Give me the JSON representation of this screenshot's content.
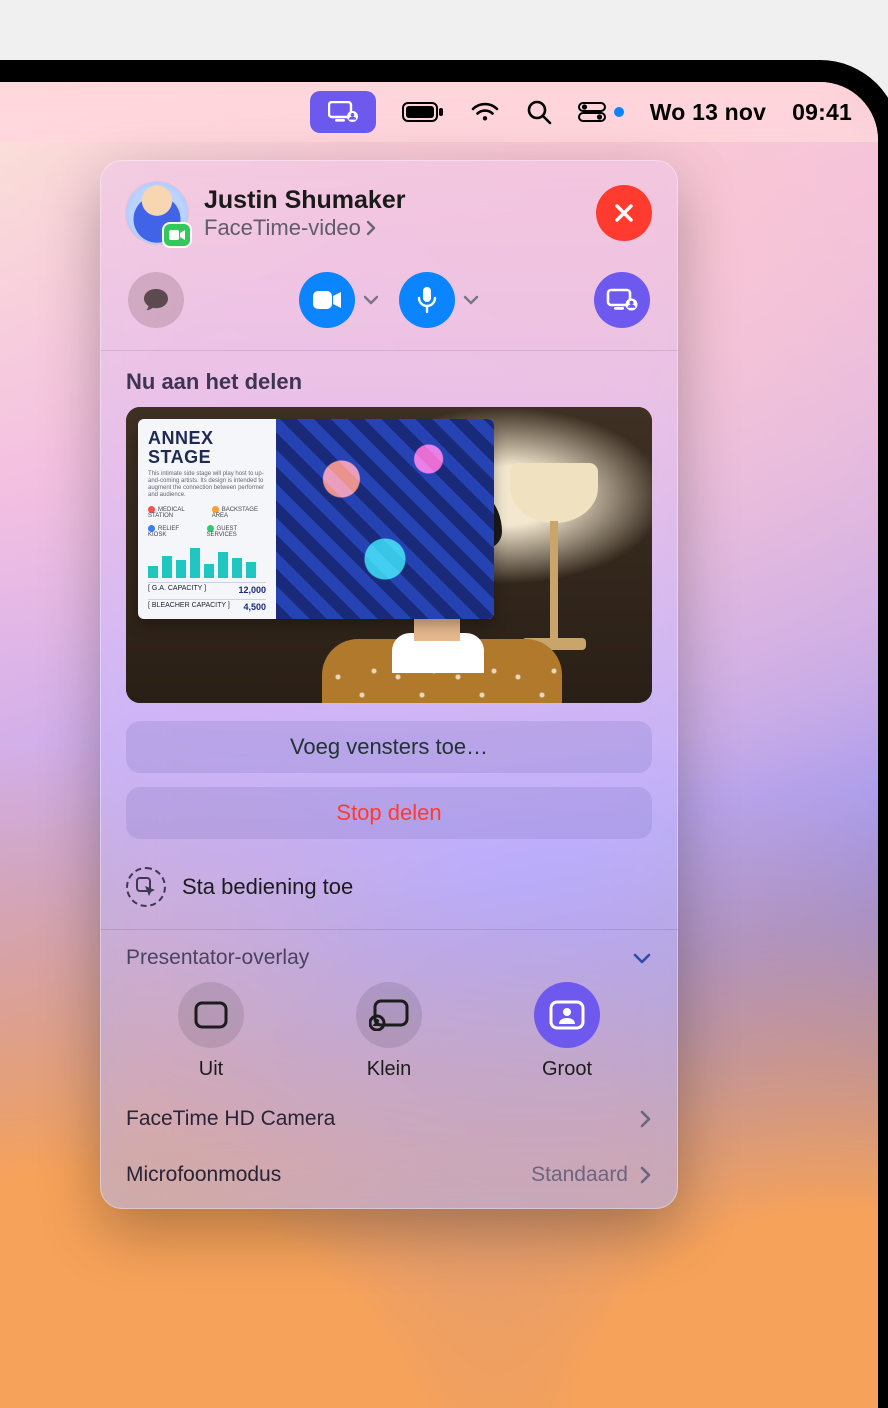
{
  "menubar": {
    "date": "Wo 13 nov",
    "time": "09:41"
  },
  "call": {
    "name": "Justin Shumaker",
    "subtitle": "FaceTime-video"
  },
  "sharing": {
    "title": "Nu aan het delen",
    "slide": {
      "heading1": "ANNEX",
      "heading2": "STAGE",
      "legend": [
        "MEDICAL STATION",
        "BACKSTAGE AREA",
        "RELIEF KIOSK",
        "GUEST SERVICES"
      ],
      "bars": [
        12,
        22,
        18,
        30,
        14,
        26,
        20,
        16
      ],
      "stat1_label": "G.A. CAPACITY",
      "stat1_value": "12,000",
      "stat2_label": "BLEACHER CAPACITY",
      "stat2_value": "4,500"
    },
    "add_windows": "Voeg vensters toe…",
    "stop": "Stop delen",
    "allow_control": "Sta bediening toe"
  },
  "overlay": {
    "section": "Presentator-overlay",
    "options": {
      "off": "Uit",
      "small": "Klein",
      "large": "Groot"
    }
  },
  "rows": {
    "camera": "FaceTime HD Camera",
    "mic_mode": "Microfoonmodus",
    "mic_value": "Standaard"
  }
}
